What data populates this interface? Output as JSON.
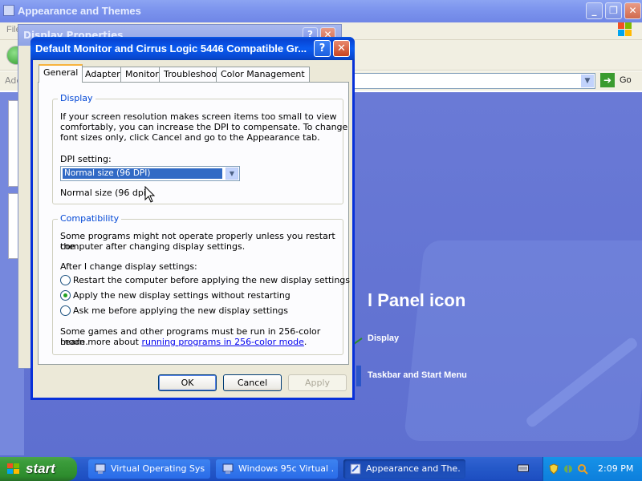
{
  "background_window": {
    "title": "Appearance and Themes",
    "menu_text": "File",
    "address_label": "Address",
    "go_label": "Go",
    "content": {
      "heading": "l Panel icon",
      "links": [
        "Display",
        "Taskbar and Start Menu"
      ]
    }
  },
  "display_properties_window": {
    "title": "Display Properties"
  },
  "dialog": {
    "title": "Default Monitor and Cirrus Logic 5446 Compatible Gr...",
    "tabs": [
      "General",
      "Adapter",
      "Monitor",
      "Troubleshoot",
      "Color Management"
    ],
    "active_tab": "General",
    "display_group": {
      "legend": "Display",
      "description_lines": [
        "If your screen resolution makes screen items too small to view",
        "comfortably, you can increase the DPI to compensate.  To change",
        "font sizes only, click Cancel and go to the Appearance tab."
      ],
      "dpi_label": "DPI setting:",
      "dpi_value": "Normal size (96 DPI)",
      "dpi_note": "Normal size (96 dpi)"
    },
    "compat_group": {
      "legend": "Compatibility",
      "intro_lines": [
        "Some programs might not operate properly unless you restart the",
        "computer after changing display settings."
      ],
      "after_label": "After I change display settings:",
      "options": [
        {
          "label": "Restart the computer before applying the new display settings",
          "selected": false
        },
        {
          "label": "Apply the new display settings without restarting",
          "selected": true
        },
        {
          "label": "Ask me before applying the new display settings",
          "selected": false
        }
      ],
      "footer_line1": "Some games and other programs must be run in 256-color mode.",
      "footer_prefix": "Learn more about ",
      "footer_link": "running programs in 256-color mode",
      "footer_suffix": "."
    },
    "buttons": {
      "ok": "OK",
      "cancel": "Cancel",
      "apply": "Apply"
    }
  },
  "taskbar": {
    "start_label": "start",
    "tasks": [
      {
        "label": "Virtual Operating Sys...",
        "active": false
      },
      {
        "label": "Windows 95c Virtual ...",
        "active": false
      },
      {
        "label": "Appearance and The...",
        "active": true
      }
    ],
    "clock": "2:09 PM"
  },
  "colors": {
    "titlebar_blue": "#0a5be6",
    "desktop_blue": "#5e6fd0",
    "start_green": "#3b9c3b",
    "tab_highlight": "#f7b33d",
    "group_legend": "#0046d5"
  }
}
